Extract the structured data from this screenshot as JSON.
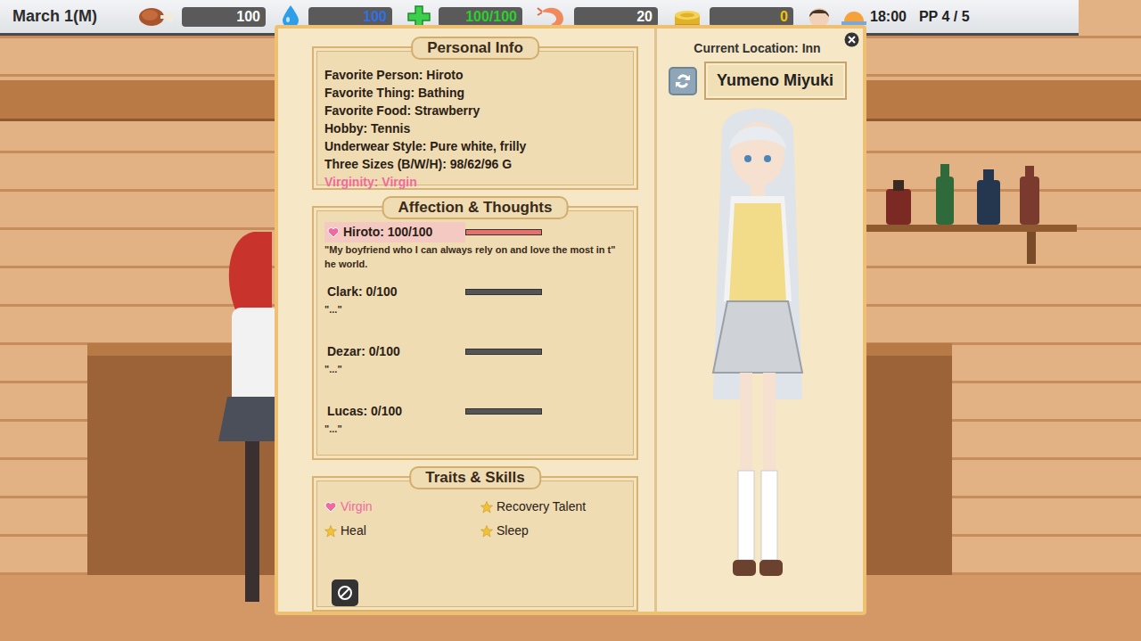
{
  "top_bar": {
    "date": "March 1(M)",
    "stats": [
      {
        "kind": "food",
        "value": "100",
        "color": "#ffffff"
      },
      {
        "kind": "water",
        "value": "100",
        "color": "#2f6fe8"
      },
      {
        "kind": "health",
        "value": "100/100",
        "color": "#2ccf2c"
      },
      {
        "kind": "shrimp",
        "value": "20",
        "color": "#ffffff"
      },
      {
        "kind": "gold",
        "value": "0",
        "color": "#f2c200"
      }
    ],
    "time": "18:00",
    "pp": "PP 4 / 5"
  },
  "panel": {
    "personal_info": {
      "title": "Personal Info",
      "lines": [
        {
          "text": "Favorite Person: Hiroto",
          "highlighted": false
        },
        {
          "text": "Favorite Thing: Bathing",
          "highlighted": false
        },
        {
          "text": "Favorite Food: Strawberry",
          "highlighted": false
        },
        {
          "text": "Hobby: Tennis",
          "highlighted": false
        },
        {
          "text": "Underwear Style: Pure white, frilly",
          "highlighted": false
        },
        {
          "text": "Three Sizes (B/W/H): 98/62/96 G",
          "highlighted": false
        },
        {
          "text": "Virginity: Virgin",
          "highlighted": true
        }
      ]
    },
    "affection": {
      "title": "Affection & Thoughts",
      "entries": [
        {
          "name": "Hiroto: 100/100",
          "level": 1,
          "favorite": true,
          "comment": [
            "\"My boyfriend who I can always rely on and love the most in t\"",
            "he world."
          ]
        },
        {
          "name": "Clark: 0/100",
          "level": 0,
          "favorite": false,
          "comment": [
            "\"...\""
          ]
        },
        {
          "name": "Dezar: 0/100",
          "level": 0,
          "favorite": false,
          "comment": [
            "\"...\""
          ]
        },
        {
          "name": "Lucas: 0/100",
          "level": 0,
          "favorite": false,
          "comment": [
            "\"...\""
          ]
        }
      ]
    },
    "traits": {
      "title": "Traits & Skills",
      "items": [
        {
          "text": "Virgin",
          "kind": "special"
        },
        {
          "text": "Recovery Talent",
          "kind": "skill"
        },
        {
          "text": "Heal",
          "kind": "skill"
        },
        {
          "text": "Sleep",
          "kind": "skill"
        }
      ]
    },
    "location": "Current Location: Inn",
    "character_name": "Yumeno Miyuki"
  }
}
